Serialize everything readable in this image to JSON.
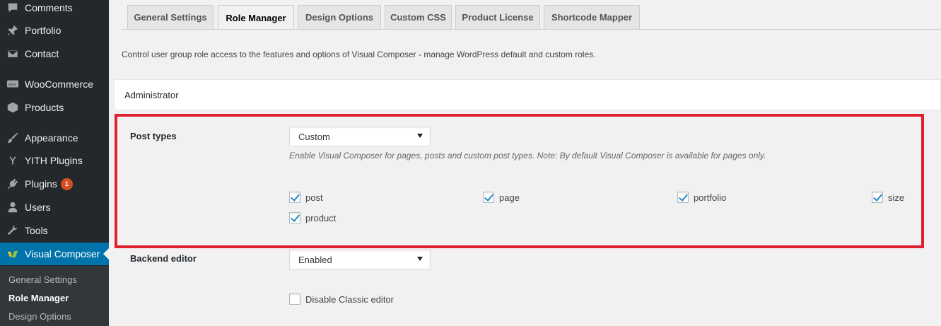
{
  "sidebar": {
    "items": [
      {
        "label": "Comments",
        "icon": "comments-icon"
      },
      {
        "label": "Portfolio",
        "icon": "pin-icon"
      },
      {
        "label": "Contact",
        "icon": "mail-icon"
      },
      {
        "label": "WooCommerce",
        "icon": "woocommerce-icon"
      },
      {
        "label": "Products",
        "icon": "products-icon"
      },
      {
        "label": "Appearance",
        "icon": "paintbrush-icon"
      },
      {
        "label": "YITH Plugins",
        "icon": "yith-icon"
      },
      {
        "label": "Plugins",
        "icon": "plugin-icon",
        "badge": "1"
      },
      {
        "label": "Users",
        "icon": "users-icon"
      },
      {
        "label": "Tools",
        "icon": "wrench-icon"
      },
      {
        "label": "Visual Composer",
        "icon": "visual-composer-icon"
      }
    ],
    "submenu": [
      "General Settings",
      "Role Manager",
      "Design Options"
    ]
  },
  "tabs": [
    "General Settings",
    "Role Manager",
    "Design Options",
    "Custom CSS",
    "Product License",
    "Shortcode Mapper"
  ],
  "description": "Control user group role access to the features and options of Visual Composer - manage WordPress default and custom roles.",
  "role": "Administrator",
  "post_types": {
    "label": "Post types",
    "select_value": "Custom",
    "help": "Enable Visual Composer for pages, posts and custom post types. Note: By default Visual Composer is available for pages only.",
    "options": [
      {
        "label": "post",
        "checked": true
      },
      {
        "label": "page",
        "checked": true
      },
      {
        "label": "portfolio",
        "checked": true
      },
      {
        "label": "size",
        "checked": true
      },
      {
        "label": "product",
        "checked": true
      }
    ]
  },
  "backend_editor": {
    "label": "Backend editor",
    "select_value": "Enabled",
    "disable_classic_label": "Disable Classic editor",
    "disable_classic_checked": false
  },
  "colors": {
    "sidebar_bg": "#23282d",
    "active_blue": "#0073aa",
    "highlight_red": "#e0202f",
    "badge_orange": "#d54e21"
  }
}
